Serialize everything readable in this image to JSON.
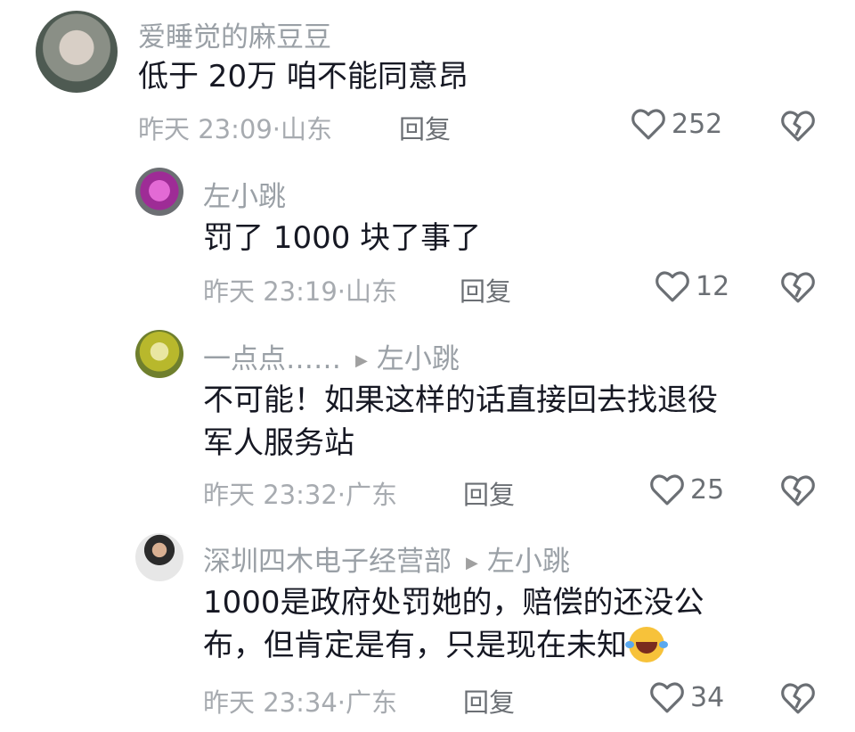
{
  "comments": [
    {
      "username": "爱睡觉的麻豆豆",
      "reply_to": "",
      "text_lines": [
        "低于 20万 咱不能同意昂"
      ],
      "time": "昨天 23:09",
      "location": "山东",
      "reply_label": "回复",
      "likes": "252"
    },
    {
      "username": "左小跳",
      "reply_to": "",
      "text_lines": [
        "罚了 1000 块了事了"
      ],
      "time": "昨天 23:19",
      "location": "山东",
      "reply_label": "回复",
      "likes": "12"
    },
    {
      "username": "一点点……",
      "reply_to": "左小跳",
      "text_lines": [
        "不可能！如果这样的话直接回去找退役",
        "军人服务站"
      ],
      "time": "昨天 23:32",
      "location": "广东",
      "reply_label": "回复",
      "likes": "25"
    },
    {
      "username": "深圳四木电子经营部",
      "reply_to": "左小跳",
      "text_lines": [
        "1000是政府处罚她的，赔偿的还没公",
        "布，但肯定是有，只是现在未知"
      ],
      "time": "昨天 23:34",
      "location": "广东",
      "reply_label": "回复",
      "likes": "34"
    }
  ],
  "separator": "·",
  "icons": {
    "like": "heart-outline-icon",
    "dislike": "broken-heart-icon",
    "reply_arrow": "triangle-right-icon",
    "emoji": "rolling-on-floor-laughing-emoji"
  }
}
